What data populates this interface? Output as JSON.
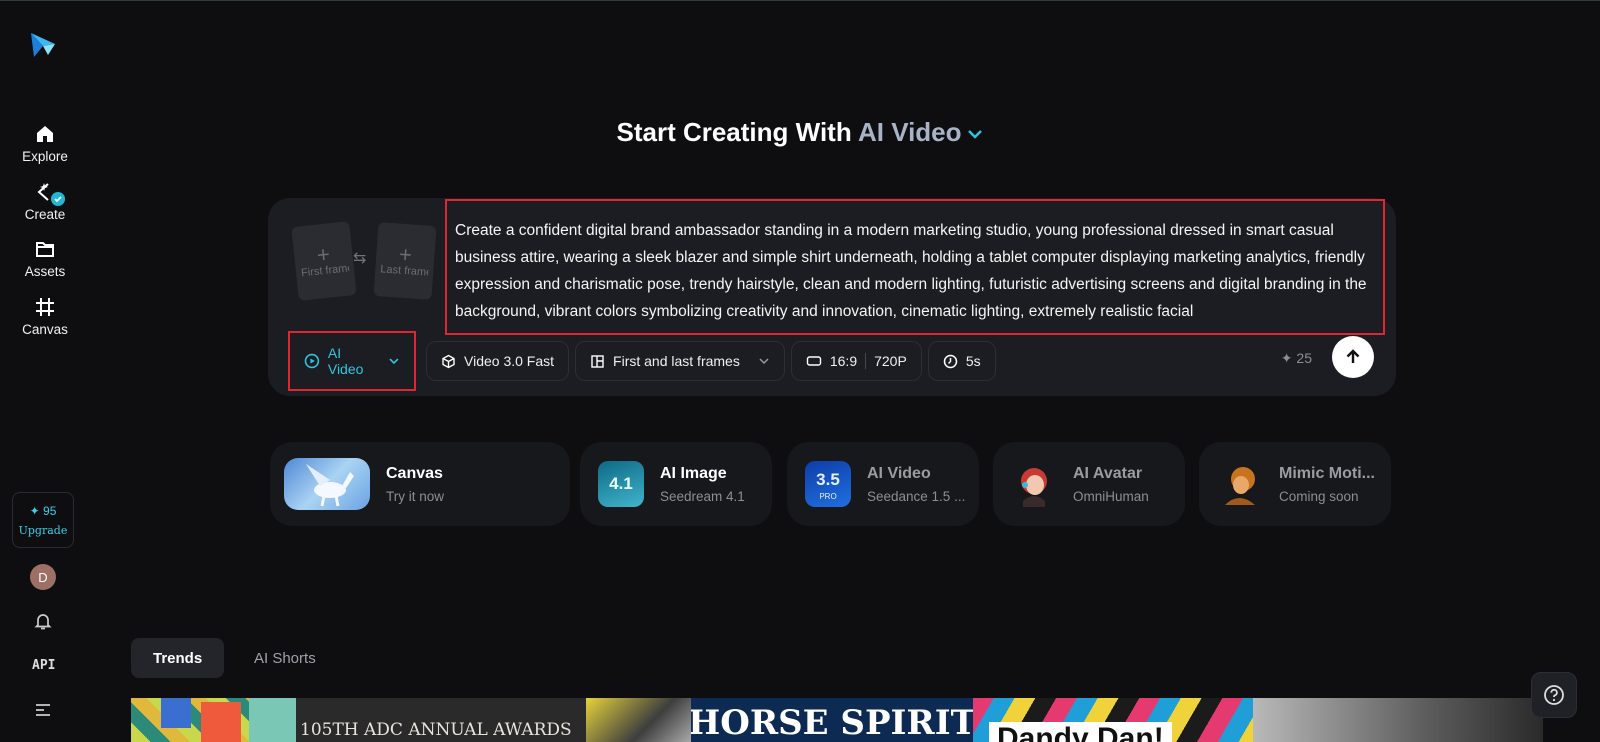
{
  "sidebar": {
    "items": [
      {
        "label": "Explore",
        "icon": "home-icon"
      },
      {
        "label": "Create",
        "icon": "create-icon"
      },
      {
        "label": "Assets",
        "icon": "folder-icon"
      },
      {
        "label": "Canvas",
        "icon": "canvas-icon"
      }
    ],
    "credits": "95",
    "upgrade_label": "Upgrade",
    "avatar_initial": "D",
    "api_label": "API"
  },
  "hero": {
    "title_prefix": "Start Creating With",
    "title_accent": "AI Video"
  },
  "prompt": {
    "first_frame_label": "First frame",
    "last_frame_label": "Last frame",
    "text": "Create a confident digital brand ambassador standing in a modern marketing studio, young professional dressed in smart casual business attire, wearing a sleek blazer and simple shirt underneath, holding a tablet computer displaying marketing analytics, friendly expression and charismatic pose, trendy hairstyle, clean and modern lighting, futuristic advertising screens and digital branding in the background, vibrant colors symbolizing creativity and innovation, cinematic lighting, extremely realistic facial"
  },
  "toolbar": {
    "mode": "AI Video",
    "model": "Video 3.0 Fast",
    "frames_mode": "First and last frames",
    "aspect": "16:9",
    "resolution": "720P",
    "duration": "5s",
    "cost": "25"
  },
  "features": [
    {
      "title": "Canvas",
      "subtitle": "Try it now"
    },
    {
      "title": "AI Image",
      "subtitle": "Seedream 4.1",
      "badge": "4.1"
    },
    {
      "title": "AI Video",
      "subtitle": "Seedance 1.5 ...",
      "badge": "3.5",
      "badge_sub": "PRO"
    },
    {
      "title": "AI Avatar",
      "subtitle": "OmniHuman"
    },
    {
      "title": "Mimic Moti...",
      "subtitle": "Coming soon"
    }
  ],
  "tabs": [
    {
      "label": "Trends",
      "active": true
    },
    {
      "label": "AI Shorts",
      "active": false
    }
  ],
  "trends": [
    {
      "caption": "105TH ADC ANNUAL AWARDS"
    },
    {
      "caption": "HORSE SPIRIT"
    },
    {
      "caption": "Dandy Dan!"
    }
  ],
  "colors": {
    "accent": "#2ec6df",
    "highlight_border": "#e0262f",
    "background": "#0e0e11",
    "panel": "#1c1d22"
  }
}
